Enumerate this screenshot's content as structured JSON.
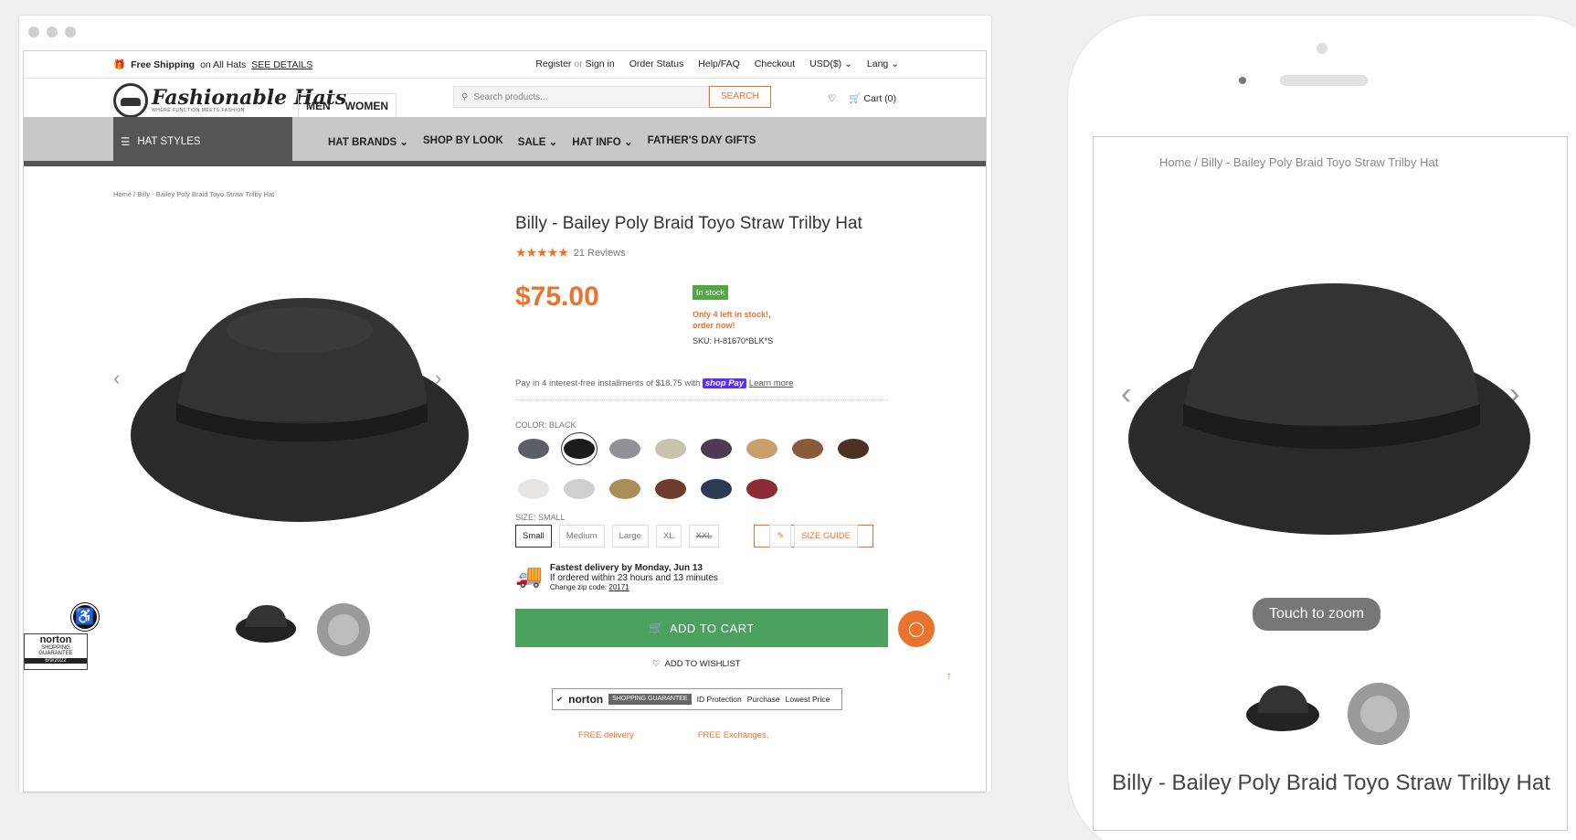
{
  "desktop": {
    "topbar": {
      "free_shipping": "Free Shipping",
      "shipping_rest": "on All Hats",
      "see_details": "SEE DETAILS",
      "register": "Register",
      "or": "or",
      "sign_in": "Sign in",
      "order_status": "Order Status",
      "help": "Help/FAQ",
      "checkout": "Checkout",
      "currency": "USD($)",
      "lang": "Lang"
    },
    "header": {
      "logo_text": "Fashionable Hats",
      "logo_tagline": "WHERE FUNCTION MEETS FASHION",
      "men": "MEN",
      "women": "WOMEN",
      "search_placeholder": "Search products...",
      "search_button": "SEARCH",
      "cart": "Cart (0)"
    },
    "nav": {
      "hat_styles": "HAT STYLES",
      "items": [
        "HAT BRANDS",
        "SHOP BY LOOK",
        "SALE",
        "HAT INFO",
        "FATHER'S DAY GIFTS"
      ]
    },
    "breadcrumb": {
      "home": "Home",
      "sep": "/",
      "current": "Billy - Bailey Poly Braid Toyo Straw Trilby Hat"
    },
    "product": {
      "title": "Billy - Bailey Poly Braid Toyo Straw Trilby Hat",
      "stars": "★★★★★",
      "rating": 5,
      "reviews": "21 Reviews",
      "price": "$75.00",
      "stock_badge": "In stock",
      "low_stock": "Only 4 left in stock!, order now!",
      "sku_label": "SKU:",
      "sku": "H-81670*BLK*S",
      "pay_text": "Pay in 4 interest-free installments of $18.75 with",
      "shop_pay": "shop Pay",
      "learn_more": "Learn more",
      "color_label": "COLOR: BLACK",
      "swatches": [
        "#5b5f66",
        "#1c1c1c",
        "#8f9196",
        "#c9c2ad",
        "#4c3b52",
        "#c9a06c",
        "#8a5a3a",
        "#4a3124",
        "#e7e5df",
        "#cfcfcb",
        "#a98e5a",
        "#6b3d2f",
        "#2c3b52",
        "#8e2a33"
      ],
      "selected_swatch": 1,
      "size_label": "SIZE: SMALL",
      "sizes": [
        "Small",
        "Medium",
        "Large",
        "XL",
        "XXL"
      ],
      "size_guide": "SIZE GUIDE",
      "delivery_title": "Fastest delivery by Monday, Jun 13",
      "delivery_sub": "If ordered within 23 hours and 13 minutes",
      "zip_label": "Change zip code:",
      "zip": "20171",
      "add_to_cart": "ADD TO CART",
      "wishlist": "ADD TO WISHLIST",
      "norton": "norton",
      "guarantee_word": "SHOPPING GUARANTEE",
      "id_protection": "ID Protection",
      "purchase": "Purchase",
      "lowest_price": "Lowest Price",
      "free_delivery": "FREE delivery",
      "free_exchanges": "FREE Exchanges,"
    },
    "norton_badge": {
      "name": "norton",
      "sub": "SHOPPING GUARANTEE",
      "date": "6/9/2022"
    }
  },
  "mobile": {
    "breadcrumb": "Home  /  Billy - Bailey Poly Braid Toyo Straw Trilby Hat",
    "touch_zoom": "Touch to zoom",
    "title": "Billy - Bailey Poly Braid Toyo Straw Trilby Hat"
  },
  "colors": {
    "accent": "#e8742e",
    "cta": "#4ca060",
    "nav_bg": "#c8c8c8",
    "nav_dark": "#555555"
  }
}
